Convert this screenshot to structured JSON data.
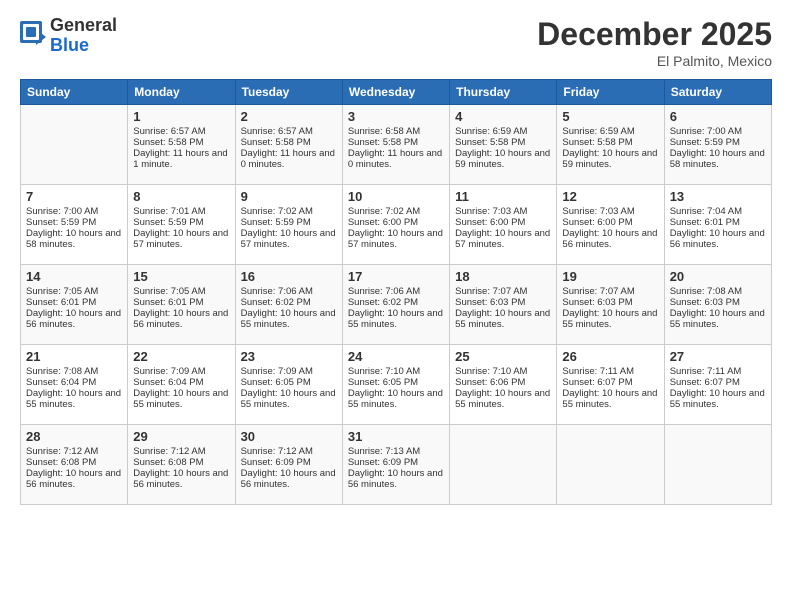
{
  "header": {
    "logo_general": "General",
    "logo_blue": "Blue",
    "month_title": "December 2025",
    "location": "El Palmito, Mexico"
  },
  "days_of_week": [
    "Sunday",
    "Monday",
    "Tuesday",
    "Wednesday",
    "Thursday",
    "Friday",
    "Saturday"
  ],
  "weeks": [
    [
      {
        "day": "",
        "sunrise": "",
        "sunset": "",
        "daylight": ""
      },
      {
        "day": "1",
        "sunrise": "Sunrise: 6:57 AM",
        "sunset": "Sunset: 5:58 PM",
        "daylight": "Daylight: 11 hours and 1 minute."
      },
      {
        "day": "2",
        "sunrise": "Sunrise: 6:57 AM",
        "sunset": "Sunset: 5:58 PM",
        "daylight": "Daylight: 11 hours and 0 minutes."
      },
      {
        "day": "3",
        "sunrise": "Sunrise: 6:58 AM",
        "sunset": "Sunset: 5:58 PM",
        "daylight": "Daylight: 11 hours and 0 minutes."
      },
      {
        "day": "4",
        "sunrise": "Sunrise: 6:59 AM",
        "sunset": "Sunset: 5:58 PM",
        "daylight": "Daylight: 10 hours and 59 minutes."
      },
      {
        "day": "5",
        "sunrise": "Sunrise: 6:59 AM",
        "sunset": "Sunset: 5:58 PM",
        "daylight": "Daylight: 10 hours and 59 minutes."
      },
      {
        "day": "6",
        "sunrise": "Sunrise: 7:00 AM",
        "sunset": "Sunset: 5:59 PM",
        "daylight": "Daylight: 10 hours and 58 minutes."
      }
    ],
    [
      {
        "day": "7",
        "sunrise": "Sunrise: 7:00 AM",
        "sunset": "Sunset: 5:59 PM",
        "daylight": "Daylight: 10 hours and 58 minutes."
      },
      {
        "day": "8",
        "sunrise": "Sunrise: 7:01 AM",
        "sunset": "Sunset: 5:59 PM",
        "daylight": "Daylight: 10 hours and 57 minutes."
      },
      {
        "day": "9",
        "sunrise": "Sunrise: 7:02 AM",
        "sunset": "Sunset: 5:59 PM",
        "daylight": "Daylight: 10 hours and 57 minutes."
      },
      {
        "day": "10",
        "sunrise": "Sunrise: 7:02 AM",
        "sunset": "Sunset: 6:00 PM",
        "daylight": "Daylight: 10 hours and 57 minutes."
      },
      {
        "day": "11",
        "sunrise": "Sunrise: 7:03 AM",
        "sunset": "Sunset: 6:00 PM",
        "daylight": "Daylight: 10 hours and 57 minutes."
      },
      {
        "day": "12",
        "sunrise": "Sunrise: 7:03 AM",
        "sunset": "Sunset: 6:00 PM",
        "daylight": "Daylight: 10 hours and 56 minutes."
      },
      {
        "day": "13",
        "sunrise": "Sunrise: 7:04 AM",
        "sunset": "Sunset: 6:01 PM",
        "daylight": "Daylight: 10 hours and 56 minutes."
      }
    ],
    [
      {
        "day": "14",
        "sunrise": "Sunrise: 7:05 AM",
        "sunset": "Sunset: 6:01 PM",
        "daylight": "Daylight: 10 hours and 56 minutes."
      },
      {
        "day": "15",
        "sunrise": "Sunrise: 7:05 AM",
        "sunset": "Sunset: 6:01 PM",
        "daylight": "Daylight: 10 hours and 56 minutes."
      },
      {
        "day": "16",
        "sunrise": "Sunrise: 7:06 AM",
        "sunset": "Sunset: 6:02 PM",
        "daylight": "Daylight: 10 hours and 55 minutes."
      },
      {
        "day": "17",
        "sunrise": "Sunrise: 7:06 AM",
        "sunset": "Sunset: 6:02 PM",
        "daylight": "Daylight: 10 hours and 55 minutes."
      },
      {
        "day": "18",
        "sunrise": "Sunrise: 7:07 AM",
        "sunset": "Sunset: 6:03 PM",
        "daylight": "Daylight: 10 hours and 55 minutes."
      },
      {
        "day": "19",
        "sunrise": "Sunrise: 7:07 AM",
        "sunset": "Sunset: 6:03 PM",
        "daylight": "Daylight: 10 hours and 55 minutes."
      },
      {
        "day": "20",
        "sunrise": "Sunrise: 7:08 AM",
        "sunset": "Sunset: 6:03 PM",
        "daylight": "Daylight: 10 hours and 55 minutes."
      }
    ],
    [
      {
        "day": "21",
        "sunrise": "Sunrise: 7:08 AM",
        "sunset": "Sunset: 6:04 PM",
        "daylight": "Daylight: 10 hours and 55 minutes."
      },
      {
        "day": "22",
        "sunrise": "Sunrise: 7:09 AM",
        "sunset": "Sunset: 6:04 PM",
        "daylight": "Daylight: 10 hours and 55 minutes."
      },
      {
        "day": "23",
        "sunrise": "Sunrise: 7:09 AM",
        "sunset": "Sunset: 6:05 PM",
        "daylight": "Daylight: 10 hours and 55 minutes."
      },
      {
        "day": "24",
        "sunrise": "Sunrise: 7:10 AM",
        "sunset": "Sunset: 6:05 PM",
        "daylight": "Daylight: 10 hours and 55 minutes."
      },
      {
        "day": "25",
        "sunrise": "Sunrise: 7:10 AM",
        "sunset": "Sunset: 6:06 PM",
        "daylight": "Daylight: 10 hours and 55 minutes."
      },
      {
        "day": "26",
        "sunrise": "Sunrise: 7:11 AM",
        "sunset": "Sunset: 6:07 PM",
        "daylight": "Daylight: 10 hours and 55 minutes."
      },
      {
        "day": "27",
        "sunrise": "Sunrise: 7:11 AM",
        "sunset": "Sunset: 6:07 PM",
        "daylight": "Daylight: 10 hours and 55 minutes."
      }
    ],
    [
      {
        "day": "28",
        "sunrise": "Sunrise: 7:12 AM",
        "sunset": "Sunset: 6:08 PM",
        "daylight": "Daylight: 10 hours and 56 minutes."
      },
      {
        "day": "29",
        "sunrise": "Sunrise: 7:12 AM",
        "sunset": "Sunset: 6:08 PM",
        "daylight": "Daylight: 10 hours and 56 minutes."
      },
      {
        "day": "30",
        "sunrise": "Sunrise: 7:12 AM",
        "sunset": "Sunset: 6:09 PM",
        "daylight": "Daylight: 10 hours and 56 minutes."
      },
      {
        "day": "31",
        "sunrise": "Sunrise: 7:13 AM",
        "sunset": "Sunset: 6:09 PM",
        "daylight": "Daylight: 10 hours and 56 minutes."
      },
      {
        "day": "",
        "sunrise": "",
        "sunset": "",
        "daylight": ""
      },
      {
        "day": "",
        "sunrise": "",
        "sunset": "",
        "daylight": ""
      },
      {
        "day": "",
        "sunrise": "",
        "sunset": "",
        "daylight": ""
      }
    ]
  ]
}
